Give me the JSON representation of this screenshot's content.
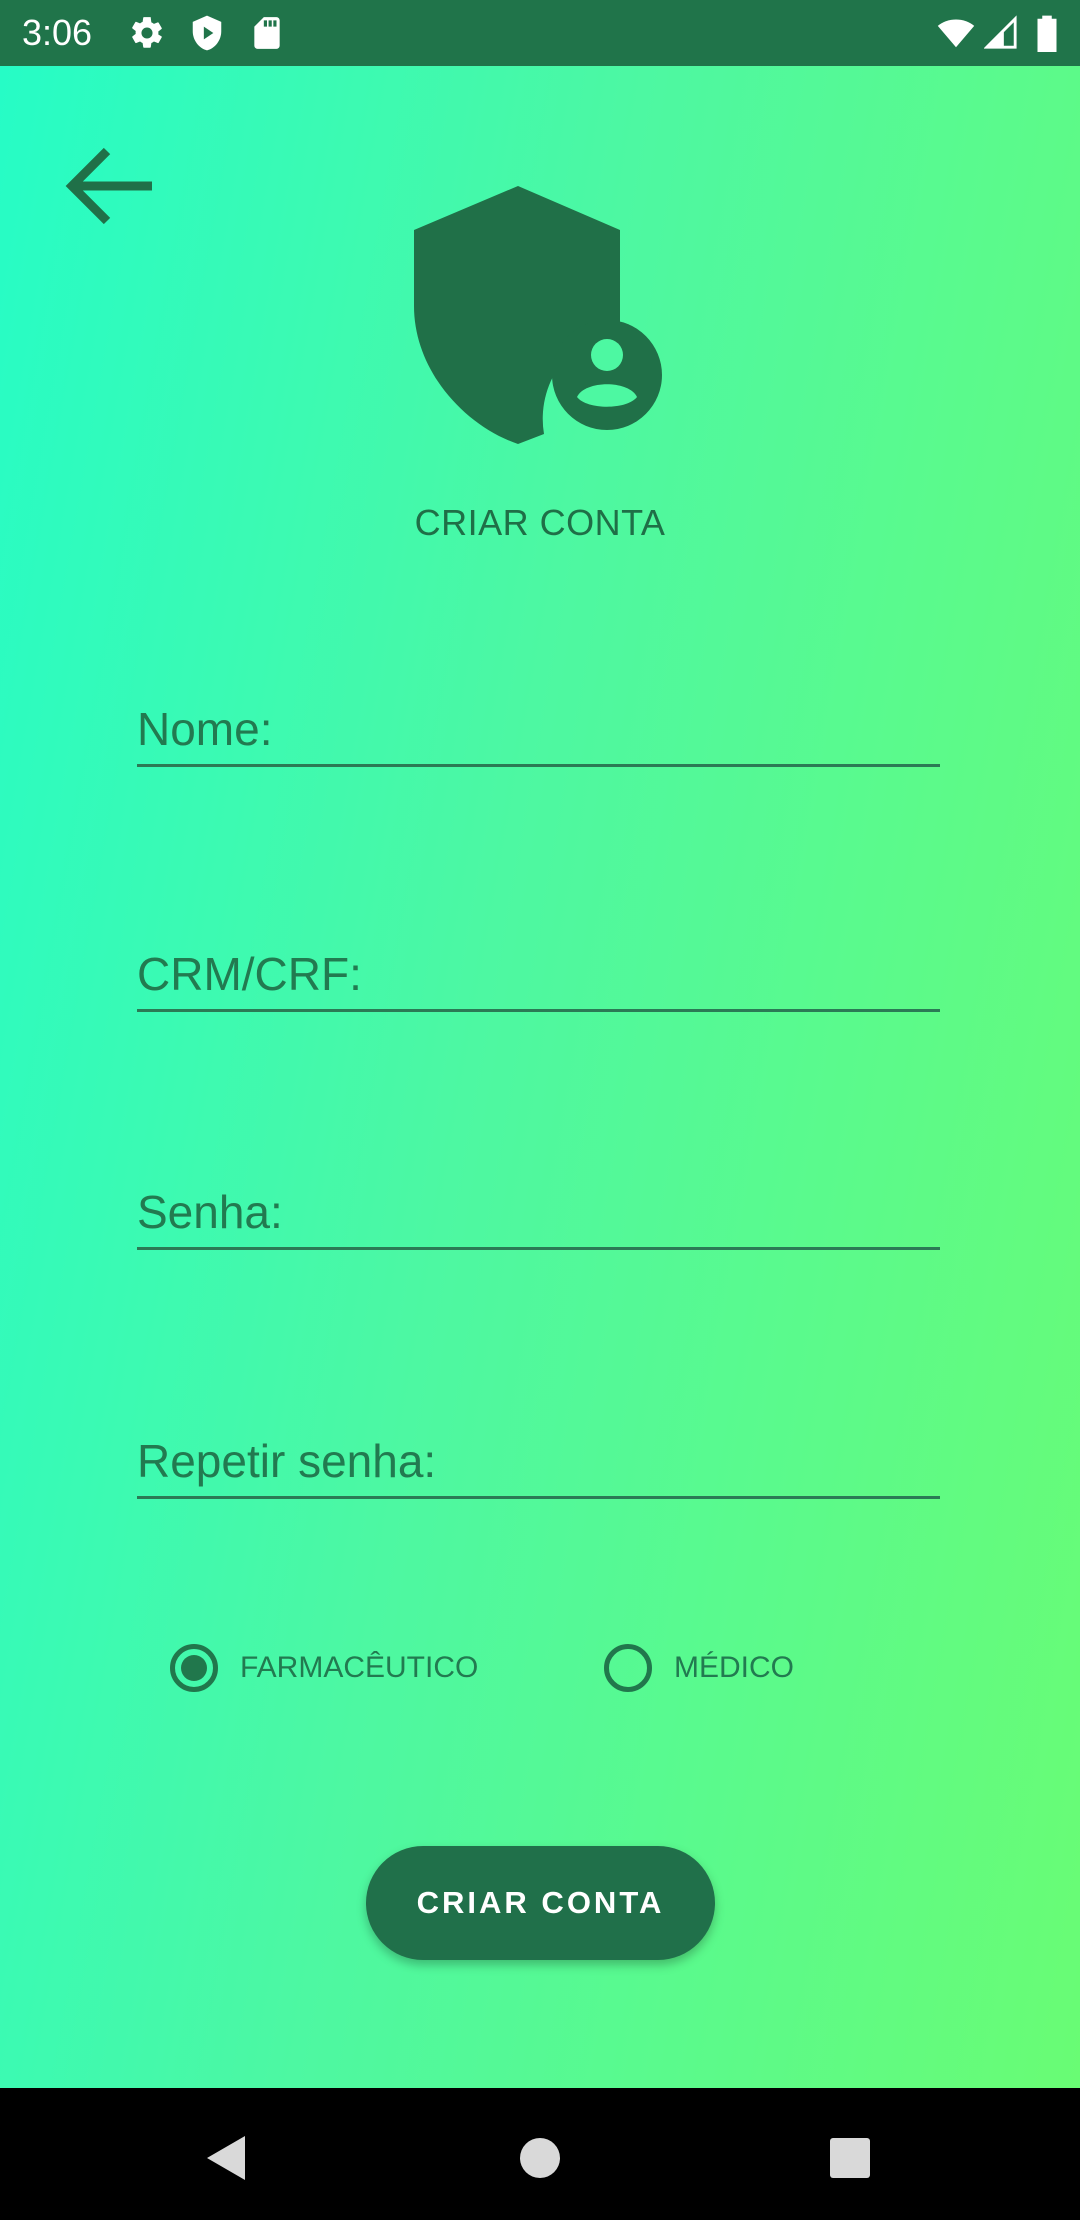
{
  "status_bar": {
    "time": "3:06",
    "icons": [
      "gear-icon",
      "shield-play-icon",
      "sd-card-icon",
      "wifi-icon",
      "signal-icon",
      "battery-icon"
    ]
  },
  "colors": {
    "accent": "#20744a",
    "gradient_start": "#26fcc6",
    "gradient_end": "#69fc74",
    "text": "#227a50"
  },
  "header": {
    "back_icon": "arrow-left-icon",
    "logo_icon": "shield-user-icon",
    "title": "CRIAR CONTA"
  },
  "form": {
    "name_placeholder": "Nome:",
    "crm_placeholder": "CRM/CRF:",
    "password_placeholder": "Senha:",
    "repeat_password_placeholder": "Repetir senha:",
    "role_options": [
      {
        "label": "FARMACÊUTICO",
        "selected": true
      },
      {
        "label": "MÉDICO",
        "selected": false
      }
    ],
    "submit_label": "CRIAR CONTA"
  },
  "nav_bar": {
    "icons": [
      "back-triangle-icon",
      "home-circle-icon",
      "recents-square-icon"
    ]
  }
}
